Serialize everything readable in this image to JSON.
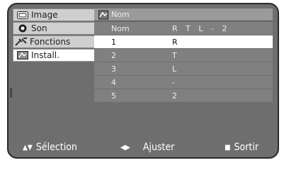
{
  "sidebar": {
    "items": [
      {
        "label": "Image",
        "icon": "image-icon"
      },
      {
        "label": "Son",
        "icon": "speaker-icon"
      },
      {
        "label": "Fonctions",
        "icon": "tools-icon"
      },
      {
        "label": "Install.",
        "icon": "install-icon"
      }
    ],
    "active_index": 3
  },
  "table": {
    "title": "Nom",
    "rows": [
      {
        "c1": "Nom",
        "c2": "R T L - 2"
      },
      {
        "c1": "1",
        "c2": "R"
      },
      {
        "c1": "2",
        "c2": "T"
      },
      {
        "c1": "3",
        "c2": "L"
      },
      {
        "c1": "4",
        "c2": "-"
      },
      {
        "c1": "5",
        "c2": "2"
      }
    ],
    "selected_row": 1
  },
  "footer": {
    "select_label": "Sélection",
    "adjust_label": "Ajuster",
    "exit_label": "Sortir"
  },
  "colors": {
    "screen_bg": "#6e6e6e",
    "selected_bg": "#ffffff",
    "text_light": "#ffffff"
  }
}
